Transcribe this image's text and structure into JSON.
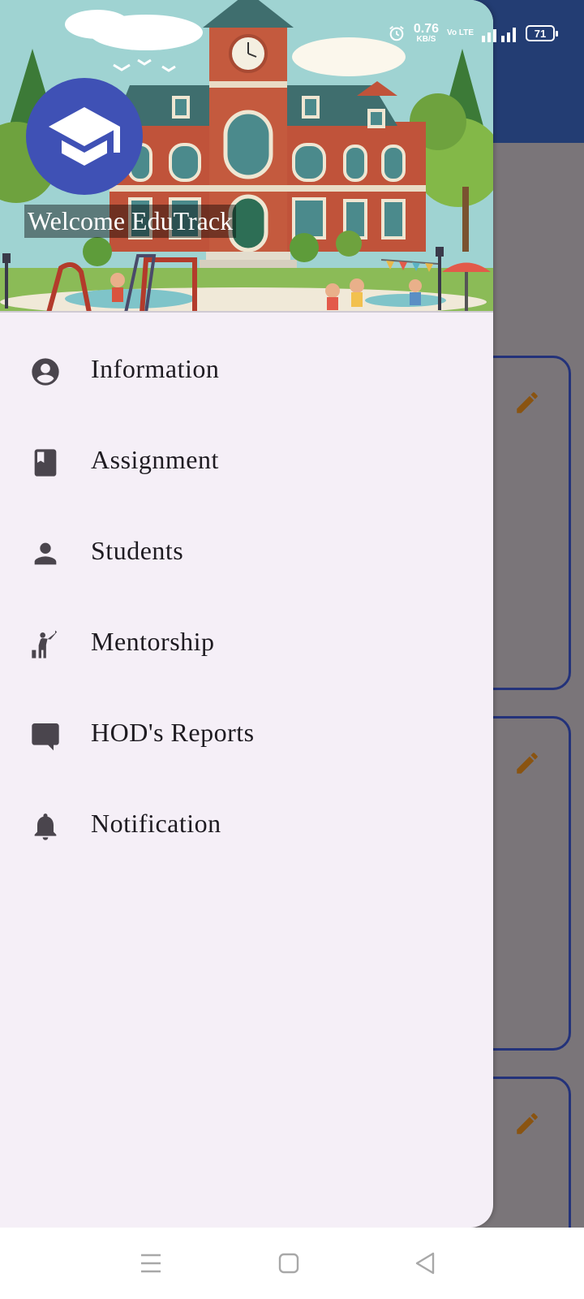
{
  "status_bar": {
    "time": "",
    "network_speed_value": "0.76",
    "network_speed_unit": "KB/S",
    "volte": "Vo LTE",
    "battery": "71"
  },
  "drawer": {
    "welcome_text": "Welcome EduTrack",
    "menu_items": [
      {
        "label": "Information",
        "icon": "account-circle-icon"
      },
      {
        "label": "Assignment",
        "icon": "book-icon"
      },
      {
        "label": "Students",
        "icon": "person-icon"
      },
      {
        "label": "Mentorship",
        "icon": "mentorship-icon"
      },
      {
        "label": "HOD's Reports",
        "icon": "chat-bubble-icon"
      },
      {
        "label": "Notification",
        "icon": "bell-icon"
      }
    ]
  },
  "colors": {
    "app_bar": "#233d73",
    "avatar": "#3f51b5",
    "drawer_bg": "#f5eff7",
    "scrim": "#7a7579",
    "card_border": "#23327a",
    "edit_icon": "#8a5411",
    "menu_icon": "#4a454d"
  }
}
